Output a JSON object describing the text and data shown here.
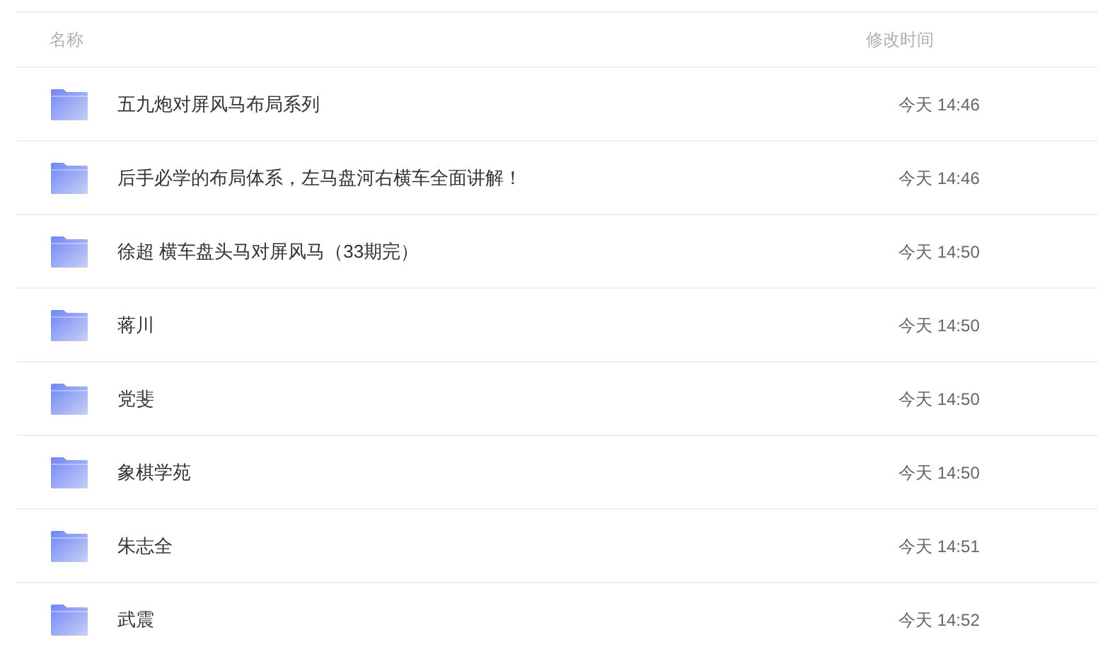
{
  "columns": [
    "名称",
    "修改时间"
  ],
  "rows": [
    {
      "name": "五九炮对屏风马布局系列",
      "modified": "今天 14:46"
    },
    {
      "name": "后手必学的布局体系，左马盘河右横车全面讲解！",
      "modified": "今天 14:46"
    },
    {
      "name": "徐超 横车盘头马对屏风马（33期完）",
      "modified": "今天 14:50"
    },
    {
      "name": "蒋川",
      "modified": "今天 14:50"
    },
    {
      "name": "党斐",
      "modified": "今天 14:50"
    },
    {
      "name": "象棋学苑",
      "modified": "今天 14:50"
    },
    {
      "name": "朱志全",
      "modified": "今天 14:51"
    },
    {
      "name": "武震",
      "modified": "今天 14:52"
    }
  ]
}
